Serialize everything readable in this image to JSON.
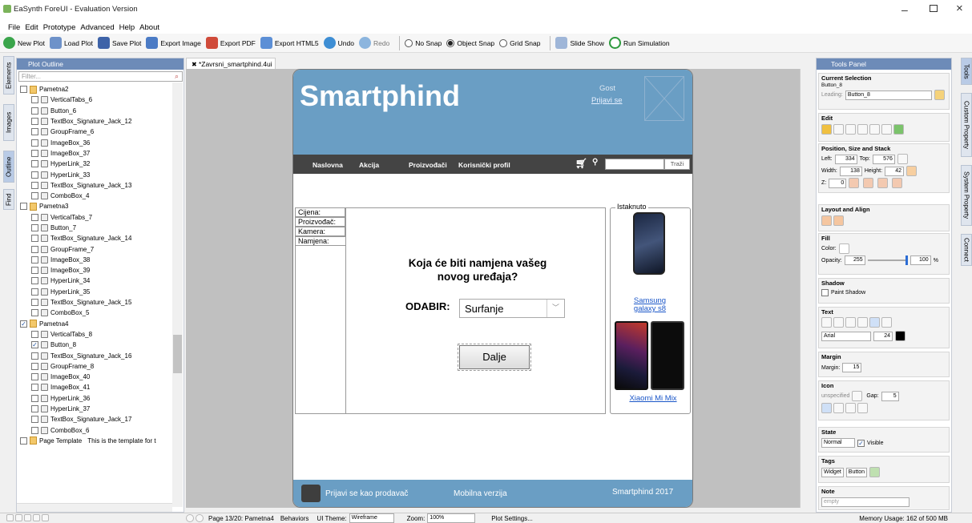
{
  "window": {
    "title": "EaSynth ForeUI - Evaluation Version"
  },
  "menu": [
    "File",
    "Edit",
    "Prototype",
    "Advanced",
    "Help",
    "About"
  ],
  "toolbar": {
    "new_plot": "New Plot",
    "load_plot": "Load Plot",
    "save_plot": "Save Plot",
    "export_image": "Export Image",
    "export_pdf": "Export PDF",
    "export_html5": "Export HTML5",
    "undo": "Undo",
    "redo": "Redo",
    "no_snap": "No Snap",
    "object_snap": "Object Snap",
    "grid_snap": "Grid Snap",
    "slide_show": "Slide Show",
    "run_simulation": "Run Simulation"
  },
  "side_tabs": [
    "Elements",
    "Images",
    "Outline",
    "Find"
  ],
  "outline": {
    "title": "Plot Outline",
    "filter_placeholder": "Filter...",
    "rows": [
      {
        "label": "Pametna2",
        "level": 0,
        "page": true,
        "checked": false
      },
      {
        "label": "VerticalTabs_6",
        "level": 1,
        "checked": false
      },
      {
        "label": "Button_6",
        "level": 1,
        "checked": false
      },
      {
        "label": "TextBox_Signature_Jack_12",
        "level": 1,
        "checked": false
      },
      {
        "label": "GroupFrame_6",
        "level": 1,
        "checked": false
      },
      {
        "label": "ImageBox_36",
        "level": 1,
        "checked": false
      },
      {
        "label": "ImageBox_37",
        "level": 1,
        "checked": false
      },
      {
        "label": "HyperLink_32",
        "level": 1,
        "checked": false
      },
      {
        "label": "HyperLink_33",
        "level": 1,
        "checked": false
      },
      {
        "label": "TextBox_Signature_Jack_13",
        "level": 1,
        "checked": false
      },
      {
        "label": "ComboBox_4",
        "level": 1,
        "checked": false
      },
      {
        "label": "Pametna3",
        "level": 0,
        "page": true,
        "checked": false
      },
      {
        "label": "VerticalTabs_7",
        "level": 1,
        "checked": false
      },
      {
        "label": "Button_7",
        "level": 1,
        "checked": false
      },
      {
        "label": "TextBox_Signature_Jack_14",
        "level": 1,
        "checked": false
      },
      {
        "label": "GroupFrame_7",
        "level": 1,
        "checked": false
      },
      {
        "label": "ImageBox_38",
        "level": 1,
        "checked": false
      },
      {
        "label": "ImageBox_39",
        "level": 1,
        "checked": false
      },
      {
        "label": "HyperLink_34",
        "level": 1,
        "checked": false
      },
      {
        "label": "HyperLink_35",
        "level": 1,
        "checked": false
      },
      {
        "label": "TextBox_Signature_Jack_15",
        "level": 1,
        "checked": false
      },
      {
        "label": "ComboBox_5",
        "level": 1,
        "checked": false
      },
      {
        "label": "Pametna4",
        "level": 0,
        "page": true,
        "checked": true
      },
      {
        "label": "VerticalTabs_8",
        "level": 1,
        "checked": false
      },
      {
        "label": "Button_8",
        "level": 1,
        "checked": true
      },
      {
        "label": "TextBox_Signature_Jack_16",
        "level": 1,
        "checked": false
      },
      {
        "label": "GroupFrame_8",
        "level": 1,
        "checked": false
      },
      {
        "label": "ImageBox_40",
        "level": 1,
        "checked": false
      },
      {
        "label": "ImageBox_41",
        "level": 1,
        "checked": false
      },
      {
        "label": "HyperLink_36",
        "level": 1,
        "checked": false
      },
      {
        "label": "HyperLink_37",
        "level": 1,
        "checked": false
      },
      {
        "label": "TextBox_Signature_Jack_17",
        "level": 1,
        "checked": false
      },
      {
        "label": "ComboBox_6",
        "level": 1,
        "checked": false
      },
      {
        "label": "Page Template",
        "level": 0,
        "page": true,
        "checked": false,
        "note": "This is the template for t"
      }
    ]
  },
  "document_tab": "*Zavrsni_smartphind.4ui",
  "design": {
    "brand": "Smartphind",
    "user": "Gost",
    "login_link": "Prijavi se",
    "nav": [
      "Naslovna",
      "Akcija",
      "Proizvođači",
      "Korisnički profil"
    ],
    "search_button": "Traži",
    "tabs": [
      "Cijena:",
      "Proizvođač:",
      "Kamera:",
      "Namjena:"
    ],
    "question": "Koja će biti namjena vašeg novog uređaja?",
    "select_label": "ODABIR:",
    "select_value": "Surfanje",
    "next_button": "Dalje",
    "featured_title": "Istaknuto",
    "phone1_link": "Samsung galaxy s8",
    "phone2_link": "Xiaomi Mi Mix",
    "footer_seller": "Prijavi se kao prodavač",
    "footer_mobile": "Mobilna verzija",
    "footer_copy": "Smartphind 2017"
  },
  "tools_panel": {
    "title": "Tools Panel",
    "current_selection": "Current Selection",
    "selected": "Button_8",
    "leading_label": "Leading:",
    "leading_value": "Button_8",
    "edit": "Edit",
    "pos_title": "Position, Size and Stack",
    "left_label": "Left:",
    "left": "334",
    "top_label": "Top:",
    "top": "576",
    "width_label": "Width:",
    "width": "138",
    "height_label": "Height:",
    "height": "42",
    "z_label": "Z:",
    "z": "0",
    "layout": "Layout and Align",
    "fill": "Fill",
    "color_label": "Color:",
    "opacity_label": "Opacity:",
    "opacity": "255",
    "opacity_pct": "100",
    "pct": "%",
    "shadow": "Shadow",
    "paint_shadow": "Paint Shadow",
    "text": "Text",
    "font": "Arial",
    "font_size": "24",
    "margin": "Margin",
    "margin_label": "Margin:",
    "margin_value": "15",
    "icon": "Icon",
    "icon_value": "unspecified",
    "gap_label": "Gap:",
    "gap": "5",
    "state": "State",
    "state_value": "Normal",
    "visible": "Visible",
    "tags": "Tags",
    "tag1": "Widget",
    "tag2": "Button",
    "note": "Note",
    "note_value": "empty"
  },
  "right_tabs": [
    "Tools",
    "Custom Property",
    "System Property",
    "Connect"
  ],
  "status": {
    "page": "Page 13/20: Pametna4",
    "behaviors": "Behaviors",
    "ui_theme_label": "UI Theme:",
    "ui_theme": "Wireframe",
    "zoom_label": "Zoom:",
    "zoom": "100%",
    "plot_settings": "Plot Settings...",
    "memory": "Memory Usage: 162 of 500 MB"
  },
  "colors": {
    "header_blue": "#6a9ec4",
    "nav_dark": "#444444",
    "panel_blue": "#6d8bb8",
    "link": "#1a56c8"
  }
}
